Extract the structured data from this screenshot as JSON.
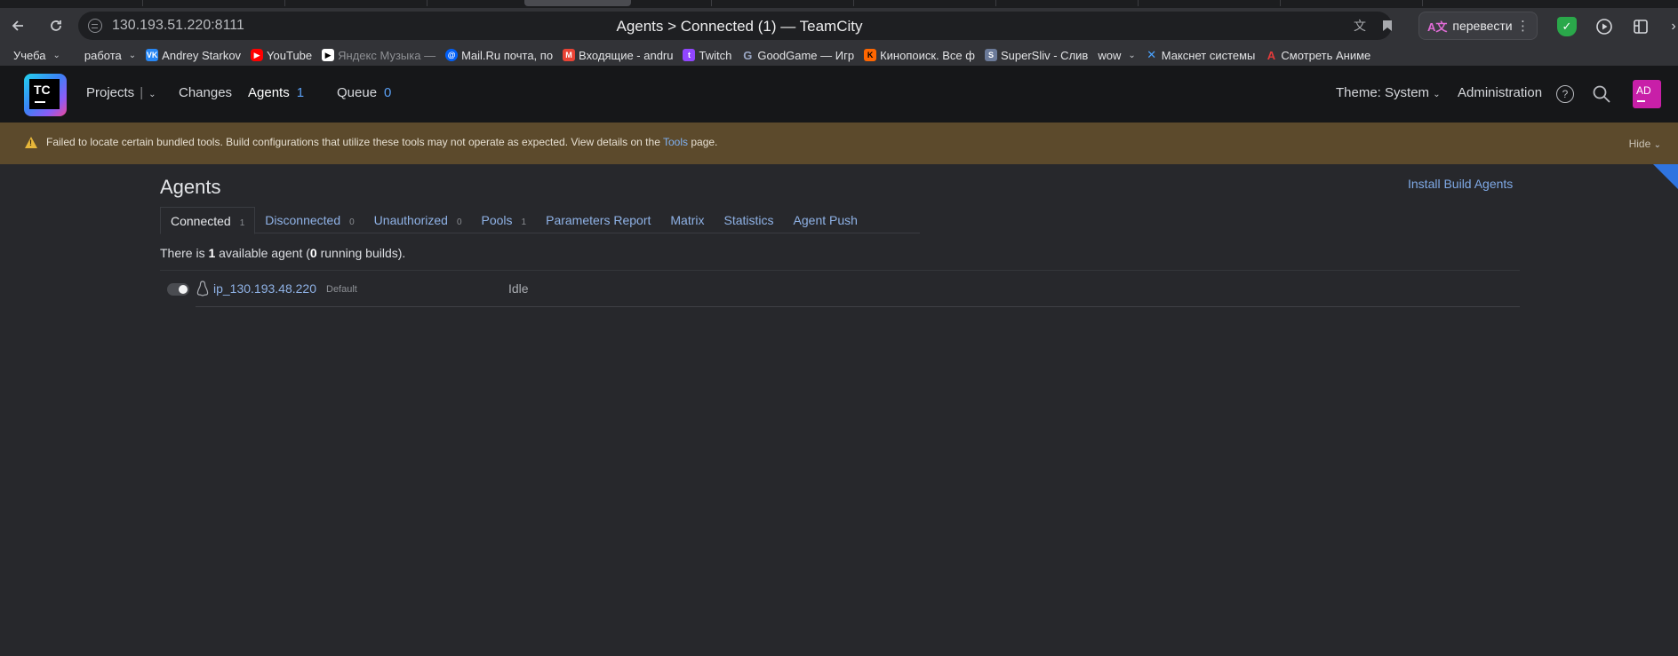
{
  "browser": {
    "url": "130.193.51.220:8111",
    "title": "Agents > Connected (1) — TeamCity",
    "translate_label": "перевести"
  },
  "bookmarks": [
    {
      "label": "Учеба",
      "icon": "folder-icon",
      "dropdown": true
    },
    {
      "label": "работа",
      "icon": "folder-icon",
      "dropdown": true
    },
    {
      "label": "Andrey Starkov",
      "icon": "vk-icon"
    },
    {
      "label": "YouTube",
      "icon": "youtube-icon"
    },
    {
      "label": "Яндекс Музыка —",
      "icon": "yandex-music-icon"
    },
    {
      "label": "Mail.Ru почта, по",
      "icon": "mailru-icon"
    },
    {
      "label": "Входящие - andru",
      "icon": "gmail-icon"
    },
    {
      "label": "Twitch",
      "icon": "twitch-icon"
    },
    {
      "label": "GoodGame — Игр",
      "icon": "goodgame-icon"
    },
    {
      "label": "Кинопоиск. Все ф",
      "icon": "kinopoisk-icon"
    },
    {
      "label": "SuperSliv - Слив",
      "icon": "supersliv-icon"
    },
    {
      "label": "wow",
      "icon": "folder-icon",
      "dropdown": true
    },
    {
      "label": "Макснет системы",
      "icon": "maksnet-icon"
    },
    {
      "label": "Смотреть Аниме",
      "icon": "anime-icon"
    }
  ],
  "header": {
    "logo_text": "TC",
    "nav": {
      "projects": "Projects",
      "changes": "Changes",
      "agents": "Agents",
      "agents_count": "1",
      "queue": "Queue",
      "queue_count": "0"
    },
    "theme": "Theme: System",
    "administration": "Administration",
    "avatar": "AD"
  },
  "warning": {
    "text_before": "Failed to locate certain bundled tools. Build configurations that utilize these tools may not operate as expected. View details on the",
    "link": "Tools",
    "text_after": "page.",
    "hide": "Hide"
  },
  "page": {
    "title": "Agents",
    "install_link": "Install Build Agents",
    "tabs": [
      {
        "label": "Connected",
        "count": "1",
        "active": true
      },
      {
        "label": "Disconnected",
        "count": "0"
      },
      {
        "label": "Unauthorized",
        "count": "0"
      },
      {
        "label": "Pools",
        "count": "1"
      },
      {
        "label": "Parameters Report",
        "count": ""
      },
      {
        "label": "Matrix",
        "count": ""
      },
      {
        "label": "Statistics",
        "count": ""
      },
      {
        "label": "Agent Push",
        "count": ""
      }
    ],
    "summary": {
      "p1": "There is ",
      "agents": "1",
      "p2": " available agent (",
      "builds": "0",
      "p3": " running builds)."
    },
    "agents": [
      {
        "name": "ip_130.193.48.220",
        "pool": "Default",
        "status": "Idle",
        "enabled": true
      }
    ]
  },
  "colors": {
    "accent": "#5aa0f5",
    "warning_bg": "#5c4a2c",
    "avatar_bg": "#c81fa8"
  }
}
